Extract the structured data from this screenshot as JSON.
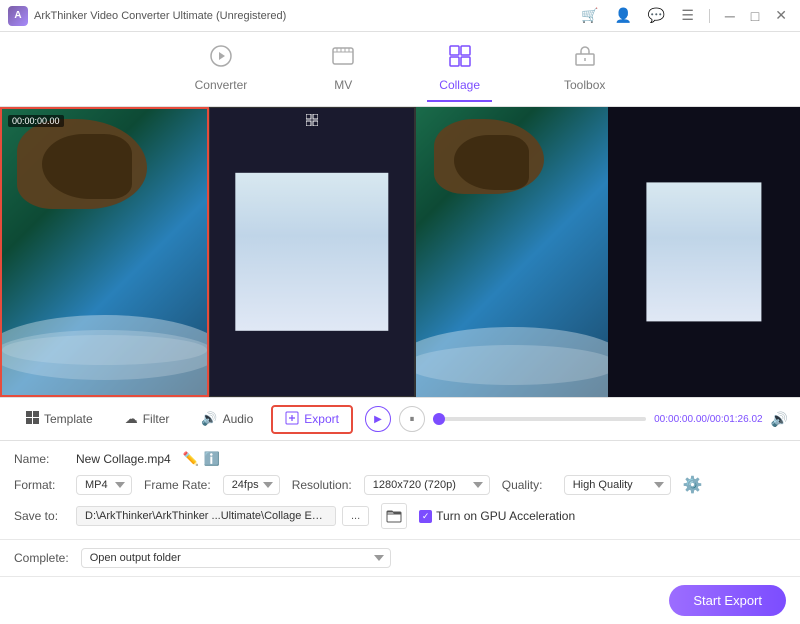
{
  "titlebar": {
    "title": "ArkThinker Video Converter Ultimate (Unregistered)",
    "logo_letter": "A",
    "controls": [
      "cart-icon",
      "person-icon",
      "chat-icon",
      "menu-icon",
      "minimize-icon",
      "maximize-icon",
      "close-icon"
    ]
  },
  "nav": {
    "tabs": [
      {
        "id": "converter",
        "label": "Converter",
        "icon": "⏺"
      },
      {
        "id": "mv",
        "label": "MV",
        "icon": "🖼"
      },
      {
        "id": "collage",
        "label": "Collage",
        "icon": "▦",
        "active": true
      },
      {
        "id": "toolbox",
        "label": "Toolbox",
        "icon": "🧰"
      }
    ]
  },
  "toolbar": {
    "tabs": [
      {
        "id": "template",
        "label": "Template",
        "icon": "▦"
      },
      {
        "id": "filter",
        "label": "Filter",
        "icon": "☁"
      },
      {
        "id": "audio",
        "label": "Audio",
        "icon": "🔊"
      },
      {
        "id": "export",
        "label": "Export",
        "icon": "📤",
        "active": true
      }
    ]
  },
  "playback": {
    "play_icon": "▶",
    "pause_icon": "⏸",
    "current_time": "00:00:00.00",
    "total_time": "00:01:26.02",
    "volume_icon": "🔊"
  },
  "settings": {
    "name_label": "Name:",
    "name_value": "New Collage.mp4",
    "format_label": "Format:",
    "format_value": "MP4",
    "framerate_label": "Frame Rate:",
    "framerate_value": "24fps",
    "resolution_label": "Resolution:",
    "resolution_value": "1280x720 (720p)",
    "quality_label": "Quality:",
    "quality_value": "High Quality",
    "saveto_label": "Save to:",
    "saveto_path": "D:\\ArkThinker\\ArkThinker ...Ultimate\\Collage Exported",
    "saveto_browse": "...",
    "gpu_label": "Turn on GPU Acceleration",
    "gpu_checked": true,
    "complete_label": "Complete:",
    "complete_value": "Open output folder"
  },
  "footer": {
    "start_export": "Start Export"
  },
  "colors": {
    "accent": "#7c4dff",
    "accent_light": "#a78bfa",
    "active_border": "#e74c3c",
    "bg_dark": "#1a1a2e"
  }
}
